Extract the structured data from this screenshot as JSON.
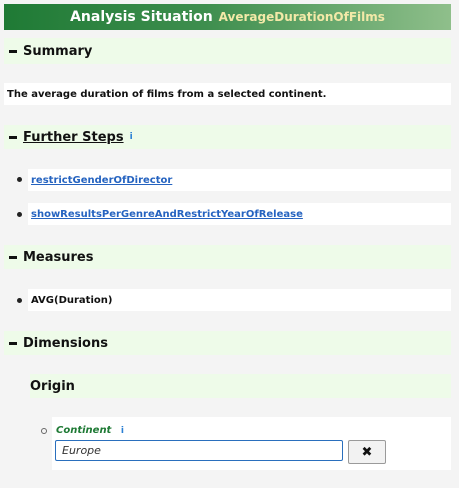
{
  "header": {
    "title": "Analysis Situation",
    "subtitle": "AverageDurationOfFilms"
  },
  "summary": {
    "heading": "Summary",
    "text": "The average duration of films from a selected continent."
  },
  "further_steps": {
    "heading": "Further Steps",
    "info": "i",
    "items": [
      "restrictGenderOfDirector",
      "showResultsPerGenreAndRestrictYearOfRelease"
    ]
  },
  "measures": {
    "heading": "Measures",
    "items": [
      "AVG(Duration)"
    ]
  },
  "dimensions": {
    "heading": "Dimensions",
    "origin": {
      "heading": "Origin",
      "continent_label": "Continent",
      "info": "i",
      "continent_value": "Europe",
      "clear_label": "✖"
    }
  },
  "colors": {
    "header": "#1f7a35",
    "section_bg": "#eefbe9",
    "link": "#2563c0"
  }
}
